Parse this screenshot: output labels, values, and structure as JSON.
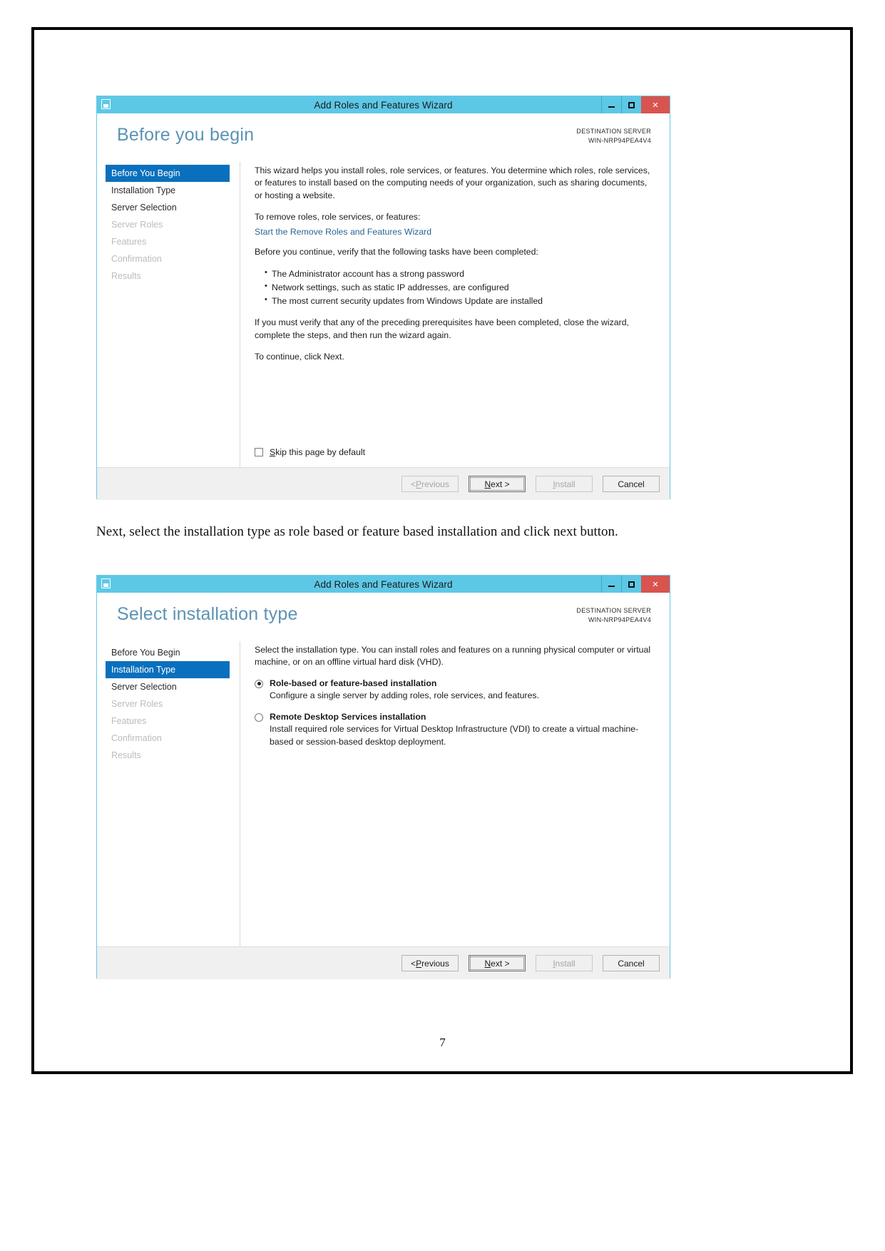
{
  "document": {
    "paragraph": "Next, select the installation type as role based or feature based installation and click next button.",
    "page_number": "7"
  },
  "wizard1": {
    "titlebar": {
      "title": "Add Roles and Features Wizard",
      "app_icon": "server-manager-icon",
      "minimize": "minimize-icon",
      "maximize": "maximize-icon",
      "close": "×"
    },
    "heading": "Before you begin",
    "destination": {
      "label": "DESTINATION SERVER",
      "server": "WIN-NRP94PEA4V4"
    },
    "nav": [
      {
        "label": "Before You Begin",
        "state": "active"
      },
      {
        "label": "Installation Type",
        "state": "normal"
      },
      {
        "label": "Server Selection",
        "state": "normal"
      },
      {
        "label": "Server Roles",
        "state": "dim"
      },
      {
        "label": "Features",
        "state": "dim"
      },
      {
        "label": "Confirmation",
        "state": "dim"
      },
      {
        "label": "Results",
        "state": "dim"
      }
    ],
    "content": {
      "intro": "This wizard helps you install roles, role services, or features. You determine which roles, role services, or features to install based on the computing needs of your organization, such as sharing documents, or hosting a website.",
      "remove_prompt": "To remove roles, role services, or features:",
      "remove_link": "Start the Remove Roles and Features Wizard",
      "verify_prompt": "Before you continue, verify that the following tasks have been completed:",
      "bullets": [
        "The Administrator account has a strong password",
        "Network settings, such as static IP addresses, are configured",
        "The most current security updates from Windows Update are installed"
      ],
      "prereq": "If you must verify that any of the preceding prerequisites have been completed, close the wizard, complete the steps, and then run the wizard again.",
      "continue": "To continue, click Next."
    },
    "skip_checkbox": {
      "label_accel": "S",
      "label_rest": "kip this page by default",
      "checked": false
    },
    "footer": {
      "previous": {
        "prefix": "< ",
        "accel": "P",
        "rest": "revious",
        "enabled": false
      },
      "next": {
        "accel": "N",
        "rest": "ext >",
        "focused": true
      },
      "install": {
        "accel": "I",
        "rest": "nstall",
        "enabled": false
      },
      "cancel": {
        "label": "Cancel",
        "enabled": true
      }
    }
  },
  "wizard2": {
    "titlebar": {
      "title": "Add Roles and Features Wizard",
      "app_icon": "server-manager-icon",
      "minimize": "minimize-icon",
      "maximize": "maximize-icon",
      "close": "×"
    },
    "heading": "Select installation type",
    "destination": {
      "label": "DESTINATION SERVER",
      "server": "WIN-NRP94PEA4V4"
    },
    "nav": [
      {
        "label": "Before You Begin",
        "state": "normal"
      },
      {
        "label": "Installation Type",
        "state": "active"
      },
      {
        "label": "Server Selection",
        "state": "normal"
      },
      {
        "label": "Server Roles",
        "state": "dim"
      },
      {
        "label": "Features",
        "state": "dim"
      },
      {
        "label": "Confirmation",
        "state": "dim"
      },
      {
        "label": "Results",
        "state": "dim"
      }
    ],
    "content": {
      "intro": "Select the installation type. You can install roles and features on a running physical computer or virtual machine, or on an offline virtual hard disk (VHD).",
      "options": [
        {
          "title": "Role-based or feature-based installation",
          "description": "Configure a single server by adding roles, role services, and features.",
          "selected": true
        },
        {
          "title": "Remote Desktop Services installation",
          "description": "Install required role services for Virtual Desktop Infrastructure (VDI) to create a virtual machine-based or session-based desktop deployment.",
          "selected": false
        }
      ]
    },
    "footer": {
      "previous": {
        "prefix": "< ",
        "accel": "P",
        "rest": "revious",
        "enabled": true
      },
      "next": {
        "accel": "N",
        "rest": "ext >",
        "focused": true
      },
      "install": {
        "accel": "I",
        "rest": "nstall",
        "enabled": false
      },
      "cancel": {
        "label": "Cancel",
        "enabled": true
      }
    }
  },
  "colors": {
    "titlebar": "#5dc8e6",
    "close_button": "#d9534f",
    "nav_active": "#0a70bd",
    "heading": "#5b93b5",
    "link": "#2a6496"
  }
}
